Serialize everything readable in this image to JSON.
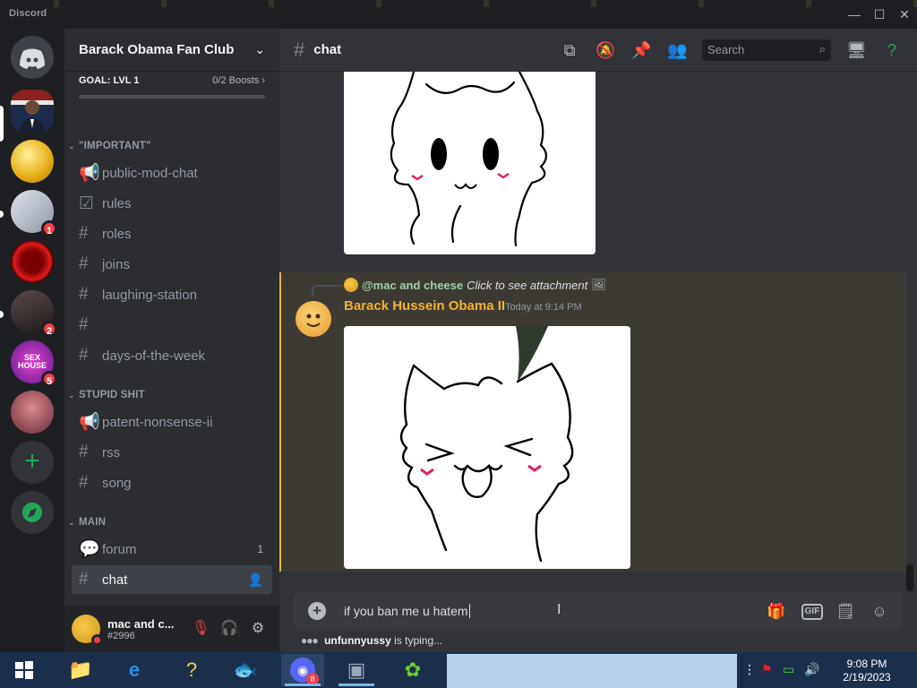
{
  "window": {
    "app_name": "Discord",
    "controls": {
      "minimize": "—",
      "maximize": "☐",
      "close": "✕"
    }
  },
  "servers": [
    {
      "name": "Direct Messages",
      "icon": "discord-logo-icon"
    },
    {
      "name": "Barack Obama Fan Club",
      "icon": "obama-avatar",
      "selected": true
    },
    {
      "name": "server-gold",
      "icon": "gold-orb"
    },
    {
      "name": "server-grey",
      "badge": "1"
    },
    {
      "name": "server-red",
      "icon": "red-ring"
    },
    {
      "name": "server-dark",
      "badge": "2"
    },
    {
      "name": "server-purple",
      "label": "SEX HOUSE",
      "badge": "5"
    },
    {
      "name": "server-pink"
    },
    {
      "name": "Add a Server",
      "icon": "plus-icon"
    },
    {
      "name": "Explore",
      "icon": "compass-icon"
    }
  ],
  "guild": {
    "name": "Barack Obama Fan Club",
    "goal_label": "GOAL: LVL 1",
    "boosts": "0/2 Boosts",
    "categories": [
      {
        "name": "\"IMPORTANT\"",
        "channels": [
          {
            "name": "public-mod-chat",
            "icon": "announcement-icon"
          },
          {
            "name": "rules",
            "icon": "checkbox-icon"
          },
          {
            "name": "roles",
            "icon": "hash-icon"
          },
          {
            "name": "joins",
            "icon": "hash-icon"
          },
          {
            "name": "laughing-station",
            "icon": "hash-icon"
          },
          {
            "name": "",
            "icon": "hash-icon"
          },
          {
            "name": "days-of-the-week",
            "icon": "hash-icon"
          }
        ]
      },
      {
        "name": "STUPID SHIT",
        "channels": [
          {
            "name": "patent-nonsense-ii",
            "icon": "announcement-icon"
          },
          {
            "name": "rss",
            "icon": "hash-icon"
          },
          {
            "name": "song",
            "icon": "hash-icon"
          }
        ]
      },
      {
        "name": "MAIN",
        "channels": [
          {
            "name": "forum",
            "icon": "forum-icon",
            "count": "1"
          },
          {
            "name": "chat",
            "icon": "hash-icon",
            "active": true
          }
        ]
      }
    ]
  },
  "user": {
    "name": "mac and c...",
    "tag": "#2996"
  },
  "channel_header": {
    "name": "chat",
    "search_placeholder": "Search"
  },
  "message": {
    "reply_mention": "@mac and cheese",
    "reply_text": "Click to see attachment",
    "author": "Barack Hussein Obama II",
    "timestamp": "Today at 9:14 PM"
  },
  "composer": {
    "text": "if you ban me u hatem",
    "gif_label": "GIF"
  },
  "typing": {
    "user": "unfunnyussy",
    "suffix": "is typing..."
  },
  "taskbar": {
    "discord_badge": "8",
    "time": "9:08 PM",
    "date": "2/19/2023"
  },
  "colors": {
    "accent_author": "#f0b232",
    "mention": "#9fcfa8",
    "badge": "#f23f43",
    "add_server": "#23a55a"
  }
}
